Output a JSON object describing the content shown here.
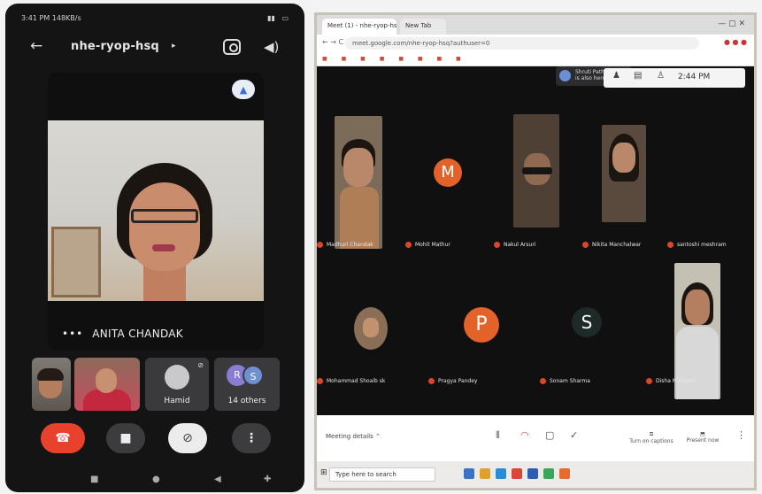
{
  "phone": {
    "status_time": "3:41 PM",
    "status_speed": "148KB/s",
    "meeting_code": "nhe-ryop-hsq",
    "main_speaker": "ANITA CHANDAK",
    "thumb_hamid": "Hamid",
    "others_initial_1": "R",
    "others_initial_2": "S",
    "others_label": "14 others"
  },
  "laptop": {
    "tab_1": "Meet (1) - nhe-ryop-hsq",
    "tab_2": "New Tab",
    "url": "meet.google.com/nhe-ryop-hsq?authuser=0",
    "clock": "2:44 PM",
    "toast_line1": "Shruti Pathak",
    "toast_line2": "is also here",
    "tiles": [
      {
        "name": "Madhuri Chandak",
        "letter": ""
      },
      {
        "name": "Mohit Mathur",
        "letter": "M"
      },
      {
        "name": "Nakul Arsuri",
        "letter": ""
      },
      {
        "name": "Nikita Manchalwar",
        "letter": ""
      },
      {
        "name": "santoshi meshram",
        "letter": ""
      },
      {
        "name": "Mohammad Shoaib sk",
        "letter": ""
      },
      {
        "name": "Pragya Pandey",
        "letter": "P"
      },
      {
        "name": "Sonam Sharma",
        "letter": "S"
      },
      {
        "name": "Disha Mahajan",
        "letter": ""
      }
    ],
    "meeting_details": "Meeting details",
    "turn_on_captions": "Turn on captions",
    "present_now": "Present now",
    "search_placeholder": "Type here to search"
  },
  "colors": {
    "end_call": "#e8412c",
    "avatar_orange": "#e2622a",
    "avatar_dark": "#1e2a28"
  }
}
